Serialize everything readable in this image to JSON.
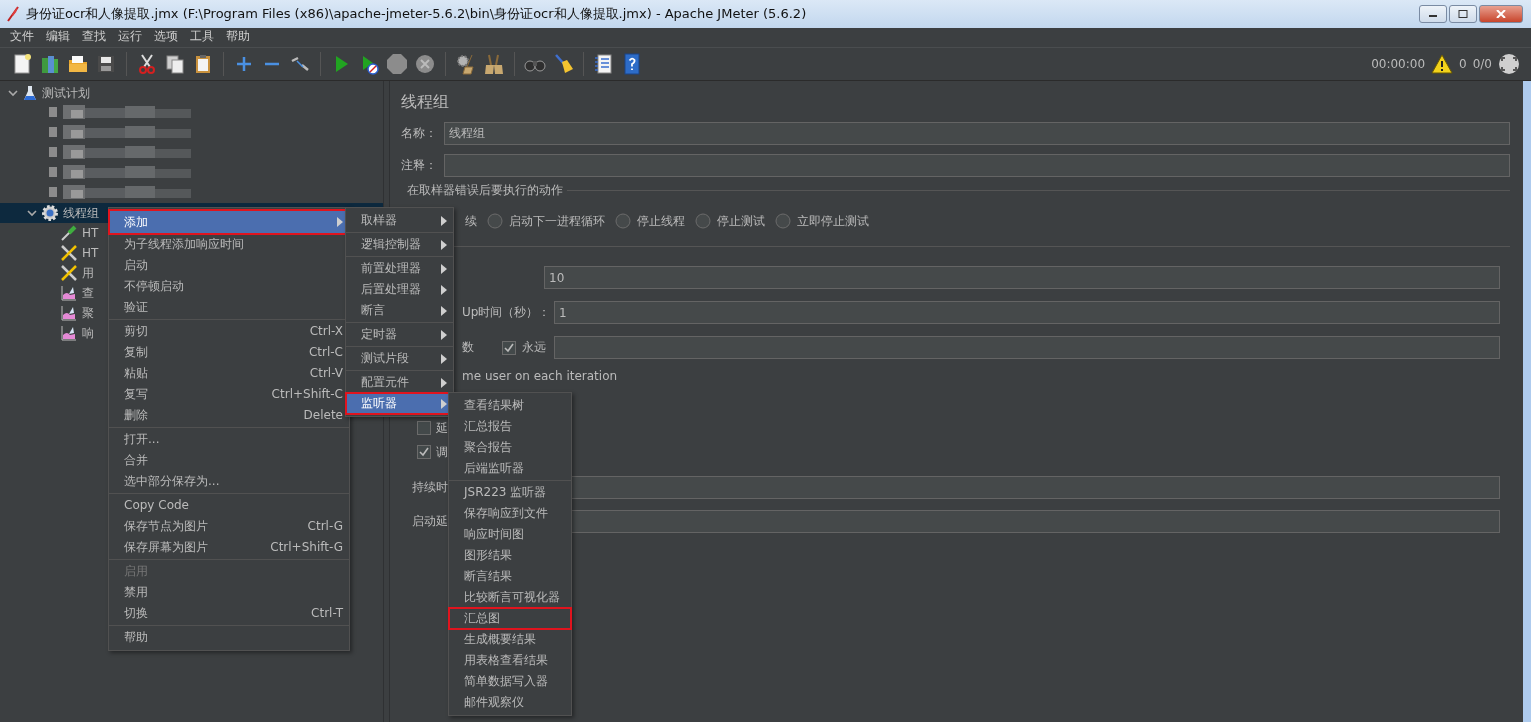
{
  "window": {
    "title": "身份证ocr和人像提取.jmx (F:\\Program Files (x86)\\apache-jmeter-5.6.2\\bin\\身份证ocr和人像提取.jmx) - Apache JMeter (5.6.2)"
  },
  "menu_bar": [
    "文件",
    "编辑",
    "查找",
    "运行",
    "选项",
    "工具",
    "帮助"
  ],
  "status": {
    "timer": "00:00:00",
    "warnings": "0",
    "threads": "0/0"
  },
  "tree": [
    {
      "kind": "plan",
      "label": "测试计划",
      "selected": false,
      "expanded": true,
      "children": [
        {
          "kind": "redacted",
          "selected": false
        },
        {
          "kind": "redacted",
          "selected": false
        },
        {
          "kind": "redacted",
          "selected": false
        },
        {
          "kind": "redacted",
          "selected": false
        },
        {
          "kind": "redacted",
          "selected": false
        },
        {
          "kind": "thread-group",
          "label": "线程组",
          "selected": true,
          "expanded": true,
          "children": [
            {
              "kind": "sampler",
              "label": "HT",
              "selected": false
            },
            {
              "kind": "config",
              "label": "HT",
              "selected": false
            },
            {
              "kind": "config",
              "label": "用",
              "selected": false
            },
            {
              "kind": "listener",
              "label": "查",
              "selected": false
            },
            {
              "kind": "listener",
              "label": "聚",
              "selected": false
            },
            {
              "kind": "listener",
              "label": "响",
              "selected": false
            }
          ]
        }
      ]
    }
  ],
  "panel": {
    "title": "线程组",
    "name_label": "名称：",
    "name_value": "线程组",
    "comment_label": "注释：",
    "error_action": {
      "legend": "在取样器错误后要执行的动作",
      "partial_label": "续",
      "options": [
        {
          "label": "启动下一进程循环",
          "selected": false
        },
        {
          "label": "停止线程",
          "selected": false
        },
        {
          "label": "停止测试",
          "selected": false
        },
        {
          "label": "立即停止测试",
          "selected": false
        }
      ]
    },
    "thread_count": {
      "value": "10"
    },
    "ramp_up": {
      "label": "Up时间（秒）：",
      "value": "1"
    },
    "loops": {
      "label": "数",
      "forever": {
        "label": "永远",
        "checked": true
      }
    },
    "same_user_text": "me user on each iteration",
    "delay_option": {
      "label": "延",
      "checked": false
    },
    "scheduler": {
      "label": "调",
      "checked": true
    },
    "duration": {
      "label": "持续时"
    },
    "startup_delay": {
      "label": "启动延"
    }
  },
  "context_menu": {
    "groups": [
      [
        {
          "label": "添加",
          "submenu": true,
          "selected": true,
          "highlighted": true,
          "disabled": false
        },
        {
          "label": "为子线程添加响应时间",
          "selected": false,
          "highlighted": false,
          "disabled": false
        },
        {
          "label": "启动",
          "selected": false,
          "highlighted": false,
          "disabled": false
        },
        {
          "label": "不停顿启动",
          "selected": false,
          "highlighted": false,
          "disabled": false
        },
        {
          "label": "验证",
          "selected": false,
          "highlighted": false,
          "disabled": false
        }
      ],
      [
        {
          "label": "剪切",
          "shortcut": "Ctrl-X",
          "selected": false,
          "highlighted": false,
          "disabled": false
        },
        {
          "label": "复制",
          "shortcut": "Ctrl-C",
          "selected": false,
          "highlighted": false,
          "disabled": false
        },
        {
          "label": "粘贴",
          "shortcut": "Ctrl-V",
          "selected": false,
          "highlighted": false,
          "disabled": false
        },
        {
          "label": "复写",
          "shortcut": "Ctrl+Shift-C",
          "selected": false,
          "highlighted": false,
          "disabled": false
        },
        {
          "label": "删除",
          "shortcut": "Delete",
          "selected": false,
          "highlighted": false,
          "disabled": false
        }
      ],
      [
        {
          "label": "打开...",
          "selected": false,
          "highlighted": false,
          "disabled": false
        },
        {
          "label": "合并",
          "selected": false,
          "highlighted": false,
          "disabled": false
        },
        {
          "label": "选中部分保存为...",
          "selected": false,
          "highlighted": false,
          "disabled": false
        }
      ],
      [
        {
          "label": "Copy Code",
          "selected": false,
          "highlighted": false,
          "disabled": false
        },
        {
          "label": "保存节点为图片",
          "shortcut": "Ctrl-G",
          "selected": false,
          "highlighted": false,
          "disabled": false
        },
        {
          "label": "保存屏幕为图片",
          "shortcut": "Ctrl+Shift-G",
          "selected": false,
          "highlighted": false,
          "disabled": false
        }
      ],
      [
        {
          "label": "启用",
          "selected": false,
          "highlighted": false,
          "disabled": true
        },
        {
          "label": "禁用",
          "selected": false,
          "highlighted": false,
          "disabled": false
        },
        {
          "label": "切换",
          "shortcut": "Ctrl-T",
          "selected": false,
          "highlighted": false,
          "disabled": false
        }
      ],
      [
        {
          "label": "帮助",
          "selected": false,
          "highlighted": false,
          "disabled": false
        }
      ]
    ]
  },
  "add_submenu": {
    "groups": [
      [
        {
          "label": "取样器",
          "submenu": true,
          "selected": false,
          "highlighted": false
        }
      ],
      [
        {
          "label": "逻辑控制器",
          "submenu": true,
          "selected": false,
          "highlighted": false
        }
      ],
      [
        {
          "label": "前置处理器",
          "submenu": true,
          "selected": false,
          "highlighted": false
        },
        {
          "label": "后置处理器",
          "submenu": true,
          "selected": false,
          "highlighted": false
        },
        {
          "label": "断言",
          "submenu": true,
          "selected": false,
          "highlighted": false
        }
      ],
      [
        {
          "label": "定时器",
          "submenu": true,
          "selected": false,
          "highlighted": false
        }
      ],
      [
        {
          "label": "测试片段",
          "submenu": true,
          "selected": false,
          "highlighted": false
        }
      ],
      [
        {
          "label": "配置元件",
          "submenu": true,
          "selected": false,
          "highlighted": false
        },
        {
          "label": "监听器",
          "submenu": true,
          "selected": true,
          "highlighted": true
        }
      ]
    ]
  },
  "listener_submenu": {
    "groups": [
      [
        {
          "label": "查看结果树",
          "selected": false,
          "highlighted": false
        },
        {
          "label": "汇总报告",
          "selected": false,
          "highlighted": false
        },
        {
          "label": "聚合报告",
          "selected": false,
          "highlighted": false
        },
        {
          "label": "后端监听器",
          "selected": false,
          "highlighted": false
        }
      ],
      [
        {
          "label": "JSR223 监听器",
          "selected": false,
          "highlighted": false
        },
        {
          "label": "保存响应到文件",
          "selected": false,
          "highlighted": false
        },
        {
          "label": "响应时间图",
          "selected": false,
          "highlighted": false
        },
        {
          "label": "图形结果",
          "selected": false,
          "highlighted": false
        },
        {
          "label": "断言结果",
          "selected": false,
          "highlighted": false
        },
        {
          "label": "比较断言可视化器",
          "selected": false,
          "highlighted": false
        },
        {
          "label": "汇总图",
          "selected": false,
          "highlighted": true
        },
        {
          "label": "生成概要结果",
          "selected": false,
          "highlighted": false
        },
        {
          "label": "用表格查看结果",
          "selected": false,
          "highlighted": false
        },
        {
          "label": "简单数据写入器",
          "selected": false,
          "highlighted": false
        },
        {
          "label": "邮件观察仪",
          "selected": false,
          "highlighted": false
        }
      ]
    ]
  }
}
